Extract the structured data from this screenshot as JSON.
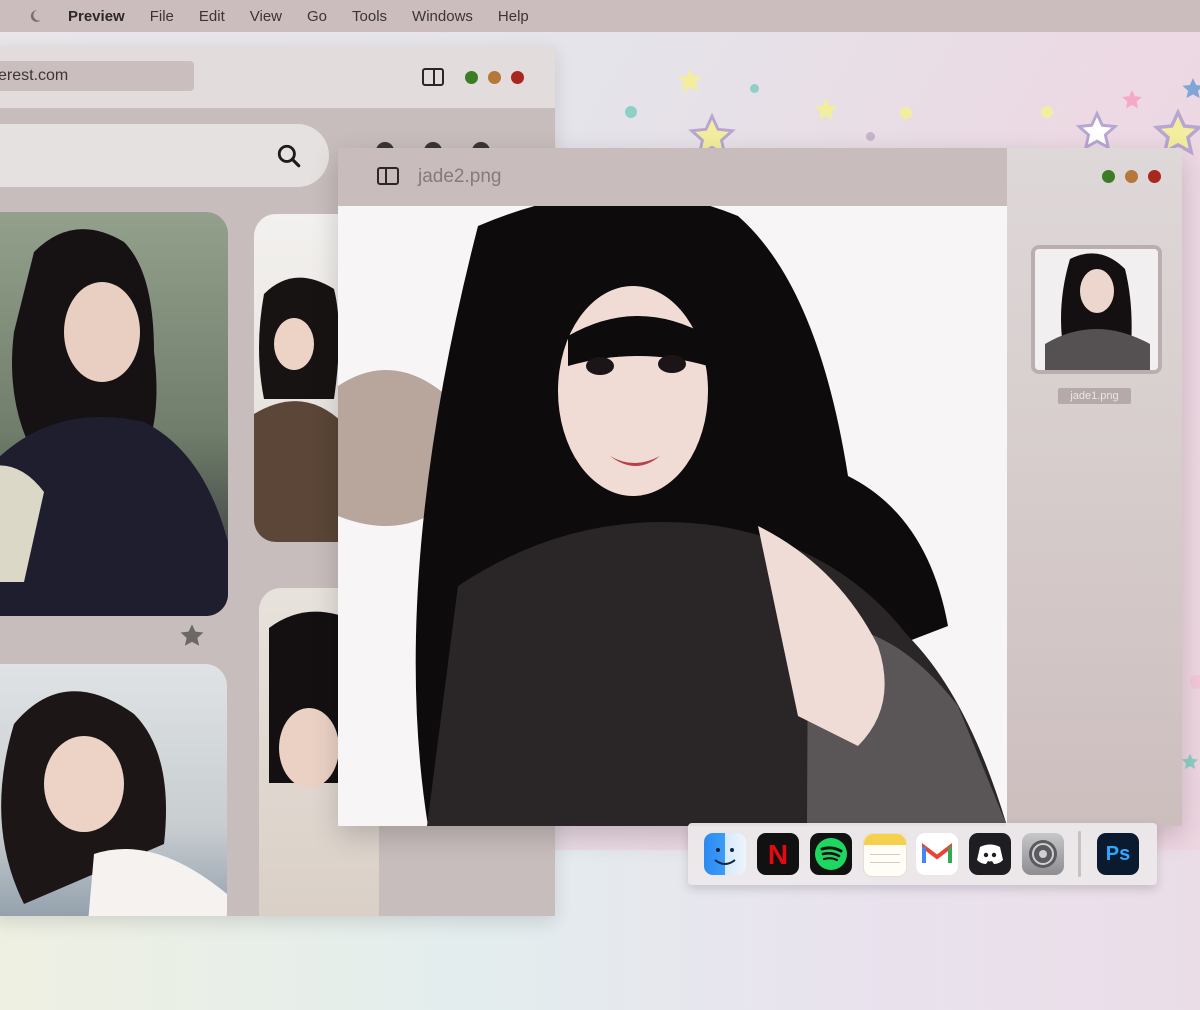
{
  "menubar": {
    "app_name": "Preview",
    "items": [
      "File",
      "Edit",
      "View",
      "Go",
      "Tools",
      "Windows",
      "Help"
    ]
  },
  "browser": {
    "url": "erest.com"
  },
  "preview": {
    "filename": "jade2.png",
    "thumbnail_label": "jade1.png"
  },
  "dock": {
    "apps": [
      "finder-icon",
      "netflix-icon",
      "spotify-icon",
      "notes-icon",
      "gmail-icon",
      "discord-icon",
      "system-settings-icon",
      "photoshop-icon"
    ],
    "netflix_letter": "N",
    "photoshop_label": "Ps"
  },
  "colors": {
    "traffic_green": "#3a7d25",
    "traffic_orange": "#b5773a",
    "traffic_red": "#a8271e"
  }
}
